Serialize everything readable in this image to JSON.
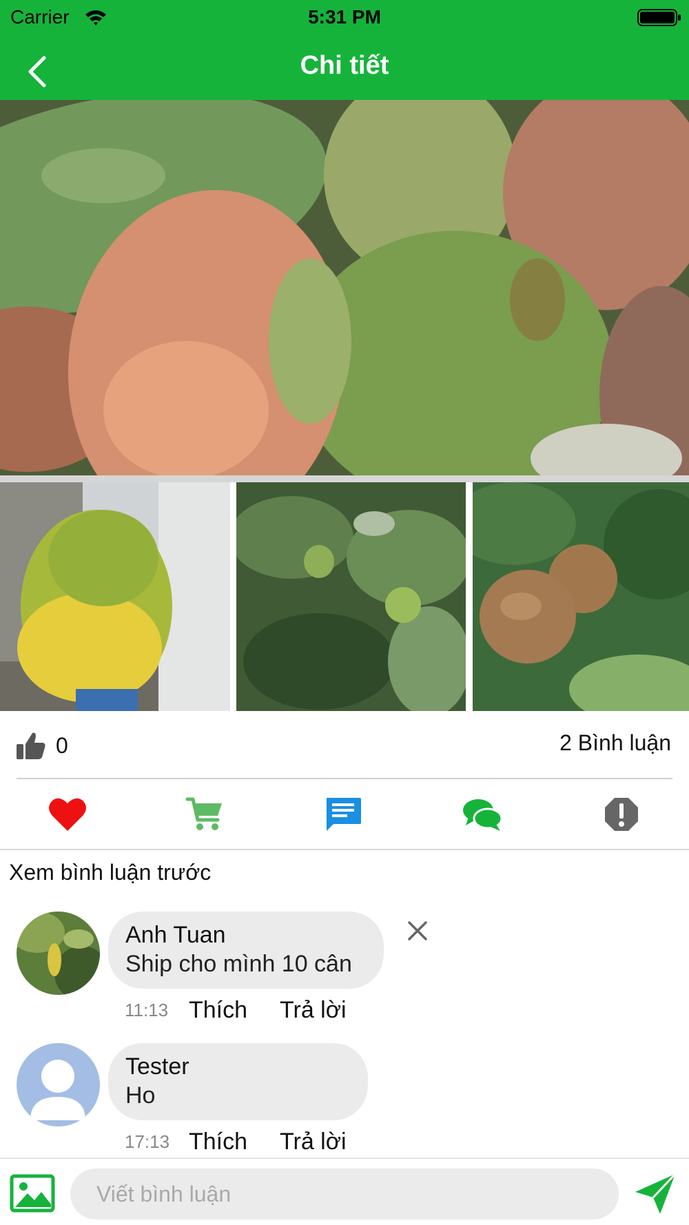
{
  "status_bar": {
    "carrier": "Carrier",
    "time": "5:31 PM"
  },
  "header": {
    "title": "Chi tiết"
  },
  "post": {
    "like_count": "0",
    "comment_count_label": "2 Bình luận"
  },
  "actions": [
    {
      "icon": "heart-icon",
      "color": "#ee1111"
    },
    {
      "icon": "shopping-cart-icon",
      "color": "#5dbb63"
    },
    {
      "icon": "description-icon",
      "color": "#1a8fe3"
    },
    {
      "icon": "chat-bubbles-icon",
      "color": "#16b33b"
    },
    {
      "icon": "report-icon",
      "color": "#666666"
    }
  ],
  "comments_section": {
    "previous_label": "Xem bình luận trước",
    "comments": [
      {
        "author": "Anh Tuan",
        "text": "Ship cho mình 10 cân",
        "time": "11:13",
        "like_label": "Thích",
        "reply_label": "Trả lời"
      },
      {
        "author": "Tester",
        "text": "Ho",
        "time": "17:13",
        "like_label": "Thích",
        "reply_label": "Trả lời"
      }
    ]
  },
  "compose": {
    "placeholder": "Viết bình luận"
  },
  "colors": {
    "brand": "#16b33b",
    "bubble": "#ebebeb"
  }
}
